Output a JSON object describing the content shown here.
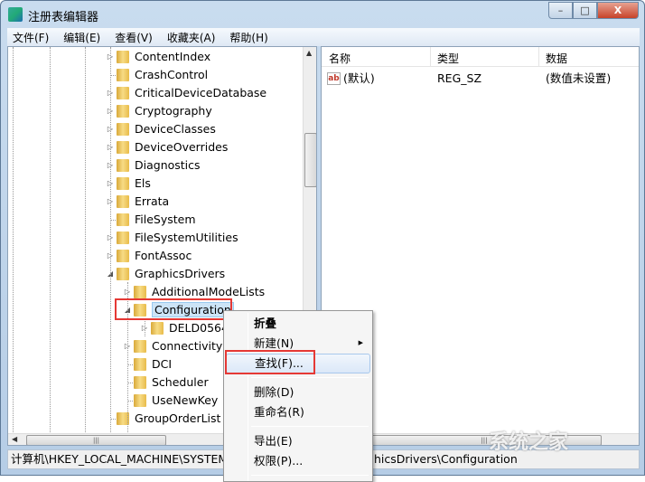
{
  "window": {
    "title": "注册表编辑器",
    "controls": {
      "minimize": "–",
      "maximize": "□",
      "close": "X"
    }
  },
  "menu": [
    "文件(F)",
    "编辑(E)",
    "查看(V)",
    "收藏夹(A)",
    "帮助(H)"
  ],
  "tree": [
    {
      "label": "ContentIndex",
      "level": 0,
      "expander": "collapsed"
    },
    {
      "label": "CrashControl",
      "level": 0,
      "expander": "none"
    },
    {
      "label": "CriticalDeviceDatabase",
      "level": 0,
      "expander": "collapsed"
    },
    {
      "label": "Cryptography",
      "level": 0,
      "expander": "collapsed"
    },
    {
      "label": "DeviceClasses",
      "level": 0,
      "expander": "collapsed"
    },
    {
      "label": "DeviceOverrides",
      "level": 0,
      "expander": "collapsed"
    },
    {
      "label": "Diagnostics",
      "level": 0,
      "expander": "collapsed"
    },
    {
      "label": "Els",
      "level": 0,
      "expander": "collapsed"
    },
    {
      "label": "Errata",
      "level": 0,
      "expander": "collapsed"
    },
    {
      "label": "FileSystem",
      "level": 0,
      "expander": "none"
    },
    {
      "label": "FileSystemUtilities",
      "level": 0,
      "expander": "collapsed"
    },
    {
      "label": "FontAssoc",
      "level": 0,
      "expander": "collapsed"
    },
    {
      "label": "GraphicsDrivers",
      "level": 0,
      "expander": "expanded"
    },
    {
      "label": "AdditionalModeLists",
      "level": 1,
      "expander": "collapsed"
    },
    {
      "label": "Configuration",
      "level": 1,
      "expander": "expanded",
      "selected": true
    },
    {
      "label": "DELD0564",
      "level": 2,
      "expander": "collapsed"
    },
    {
      "label": "Connectivity",
      "level": 1,
      "expander": "collapsed"
    },
    {
      "label": "DCI",
      "level": 1,
      "expander": "none"
    },
    {
      "label": "Scheduler",
      "level": 1,
      "expander": "none"
    },
    {
      "label": "UseNewKey",
      "level": 1,
      "expander": "none"
    },
    {
      "label": "GroupOrderList",
      "level": 0,
      "expander": "none"
    }
  ],
  "list": {
    "columns": [
      "名称",
      "类型",
      "数据"
    ],
    "rows": [
      {
        "name": "(默认)",
        "type": "REG_SZ",
        "data": "(数值未设置)",
        "icon": "ab"
      }
    ]
  },
  "context_menu": [
    {
      "label": "折叠",
      "bold": true
    },
    {
      "label": "新建(N)",
      "submenu": true
    },
    {
      "label": "查找(F)...",
      "highlighted": true
    },
    {
      "separator": true
    },
    {
      "label": "删除(D)"
    },
    {
      "label": "重命名(R)"
    },
    {
      "separator": true
    },
    {
      "label": "导出(E)"
    },
    {
      "label": "权限(P)..."
    },
    {
      "separator": true
    }
  ],
  "status": {
    "path_left": "计算机\\HKEY_LOCAL_MACHINE\\SYSTEM\\",
    "path_right": "hicsDrivers\\Configuration"
  },
  "watermark": "系统之家",
  "colors": {
    "highlight_box": "#e53935",
    "selection": "#cce4f7"
  }
}
